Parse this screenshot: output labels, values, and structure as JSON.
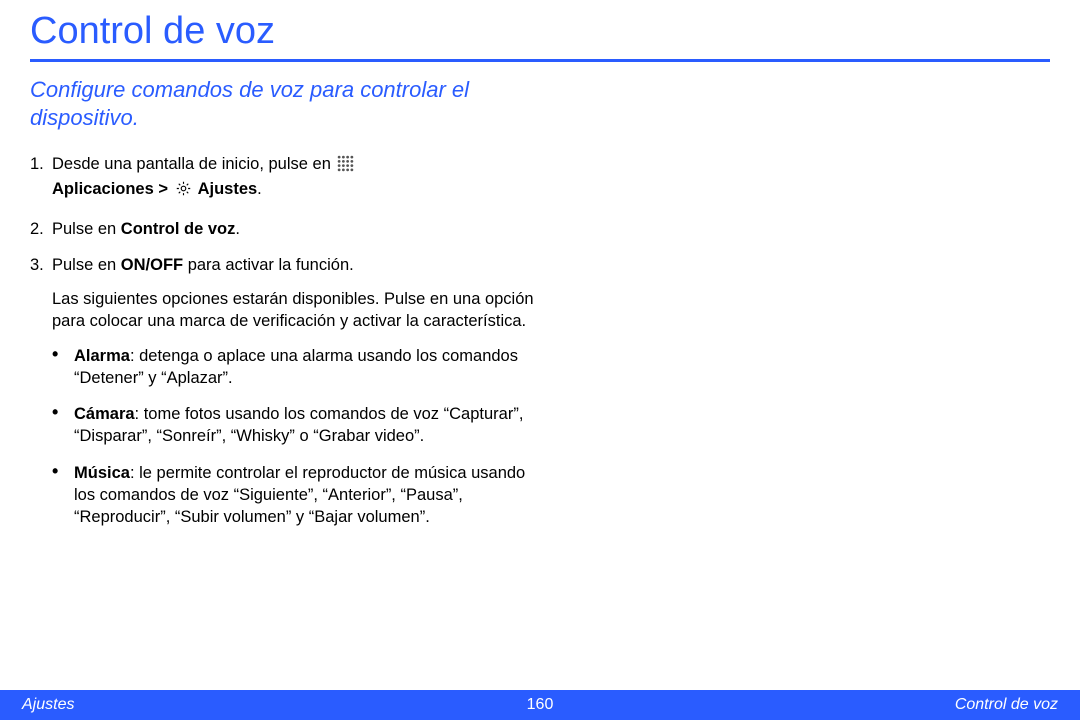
{
  "colors": {
    "accent": "#2a5cff"
  },
  "title": "Control de voz",
  "subtitle": "Configure comandos de voz para controlar el dispositivo.",
  "steps": {
    "s1_num": "1.",
    "s1_a": "Desde una pantalla de inicio, pulse en ",
    "s1_b": "Aplicaciones > ",
    "s1_c": " Ajustes",
    "s1_end": ".",
    "s2_num": "2.",
    "s2_a": "Pulse en ",
    "s2_b": "Control de voz",
    "s2_end": ".",
    "s3_num": "3.",
    "s3_a": "Pulse en ",
    "s3_b": "ON/OFF",
    "s3_c": " para activar la función.",
    "s3_para": "Las siguientes opciones estarán disponibles. Pulse en una opción para colocar una marca de verificación y activar la característica."
  },
  "bullets": {
    "alarm_b": "Alarma",
    "alarm_t": ": detenga o aplace una alarma usando los comandos “Detener” y “Aplazar”.",
    "cam_b": "Cámara",
    "cam_t": ": tome fotos usando los comandos de voz “Capturar”, “Disparar”, “Sonreír”, “Whisky” o “Grabar video”.",
    "mus_b": "Música",
    "mus_t": ": le permite controlar el reproductor de música usando los comandos de voz “Siguiente”, “Anterior”, “Pausa”, “Reproducir”, “Subir volumen” y “Bajar volumen”."
  },
  "icons": {
    "apps": "apps-grid-icon",
    "settings": "gear-icon"
  },
  "footer": {
    "left": "Ajustes",
    "center": "160",
    "right": "Control de voz"
  }
}
